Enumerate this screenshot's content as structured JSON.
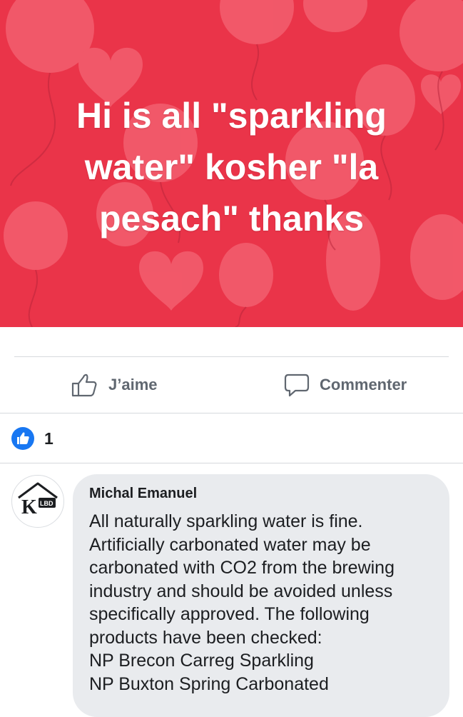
{
  "post": {
    "text": "Hi is all \"sparkling water\" kosher \"la pesach\" thanks",
    "background_color": "#ea3449"
  },
  "actions": {
    "like_label": "J’aime",
    "comment_label": "Commenter",
    "like_icon": "thumbs-up-outline-icon",
    "comment_icon": "speech-bubble-icon"
  },
  "reactions": {
    "icon": "like-reaction-icon",
    "count": "1"
  },
  "comment": {
    "author": "Michal Emanuel",
    "avatar_logo_text": "KLBD",
    "lines": [
      "All naturally sparkling water is fine.",
      "Artificially carbonated water may be",
      "carbonated with CO2 from the brewing",
      "industry and should be avoided unless",
      "specifically approved. The following",
      "products have been checked:",
      "NP Brecon Carreg Sparkling",
      "NP Buxton Spring Carbonated"
    ]
  },
  "colors": {
    "accent": "#1877f2",
    "muted_text": "#606770",
    "bubble": "#e9ebee"
  }
}
